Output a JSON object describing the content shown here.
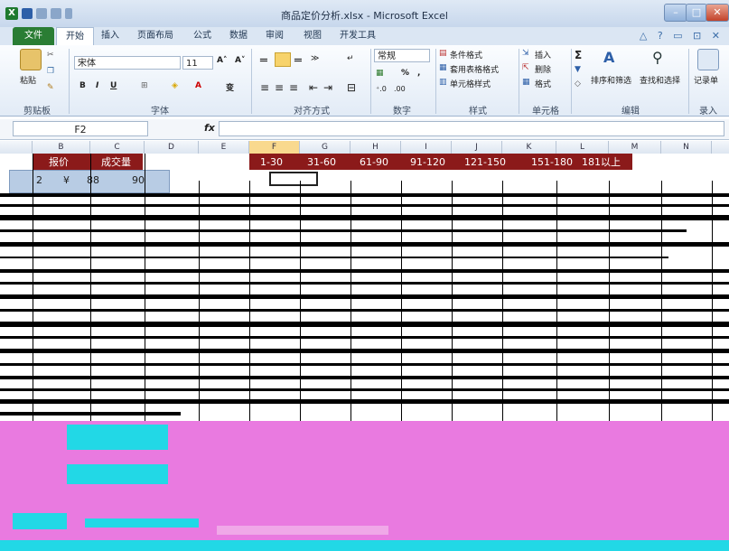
{
  "window": {
    "title": "商品定价分析.xlsx - Microsoft Excel",
    "app_icon_text": "X",
    "controls": {
      "minimize": "–",
      "maximize": "□",
      "close": "✕"
    }
  },
  "ribbon_tabs": [
    "文件",
    "开始",
    "插入",
    "页面布局",
    "公式",
    "数据",
    "审阅",
    "视图",
    "开发工具"
  ],
  "active_tab": "开始",
  "tab_right_icons": "△ ? ▭ ⊡ ✕",
  "ribbon": {
    "clipboard": {
      "label": "剪贴板",
      "paste": "粘贴"
    },
    "font": {
      "label": "字体",
      "font_name": "宋体",
      "font_size": "11",
      "bold": "B",
      "italic": "I",
      "underline": "U",
      "grow": "A˄",
      "shrink": "A˅",
      "wen": "变"
    },
    "alignment": {
      "label": "对齐方式"
    },
    "number": {
      "label": "数字",
      "format": "常规",
      "percent": "%",
      "comma": ","
    },
    "styles": {
      "label": "样式",
      "cond_format": "条件格式",
      "table_format": "套用表格格式",
      "cell_styles": "单元格样式"
    },
    "cells": {
      "label": "单元格",
      "insert": "插入",
      "delete": "删除",
      "format": "格式"
    },
    "editing": {
      "label": "编辑",
      "sum": "Σ",
      "sort_filter": "排序和筛选",
      "find_select": "查找和选择"
    },
    "record": {
      "label": "录入",
      "record_sheet": "记录单"
    }
  },
  "formula_bar": {
    "name_box": "F2",
    "fx": "fx",
    "value": ""
  },
  "columns": [
    "B",
    "C",
    "D",
    "E",
    "F",
    "G",
    "H",
    "I",
    "J",
    "K",
    "L",
    "M",
    "N"
  ],
  "selected_column": "F",
  "header_row": {
    "B": "报价",
    "C": "成交量",
    "ranges": [
      "1-30",
      "31-60",
      "61-90",
      "91-120",
      "121-150",
      "151-180",
      "181以上"
    ]
  },
  "row2": {
    "row": "2",
    "currency": "¥",
    "price": "88",
    "volume": "90"
  },
  "colors": {
    "header_bg": "#8b1a1a",
    "selection": "#b8cce4",
    "artifact_pink": "#e97ae0",
    "artifact_cyan": "#22d8e6",
    "file_tab": "#2a7d34"
  }
}
